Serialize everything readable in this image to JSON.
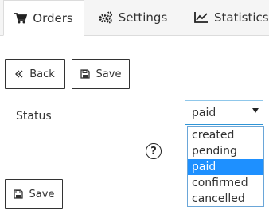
{
  "tabs": [
    {
      "label": "Orders",
      "icon": "cart-icon",
      "active": true
    },
    {
      "label": "Settings",
      "icon": "gears-icon",
      "active": false
    },
    {
      "label": "Statistics",
      "icon": "line-chart-icon",
      "active": false
    }
  ],
  "toolbar": {
    "back_label": "Back",
    "save_label": "Save"
  },
  "form": {
    "status_label": "Status",
    "status_value": "paid",
    "status_options": [
      "created",
      "pending",
      "paid",
      "confirmed",
      "cancelled"
    ],
    "help_text": "?"
  },
  "footer": {
    "save_label": "Save"
  },
  "colors": {
    "accent": "#1e90ff",
    "tab_bar_bg": "#f5f5f5",
    "select_border": "#2f95d6"
  }
}
